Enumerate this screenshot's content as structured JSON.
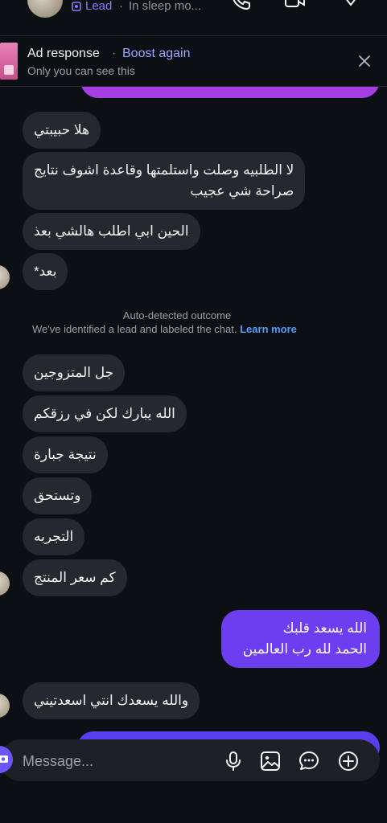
{
  "header": {
    "lead_label": "Lead",
    "separator": "·",
    "status": "In sleep mo..."
  },
  "ad_banner": {
    "title": "Ad response",
    "separator": "·",
    "boost_label": "Boost again",
    "subtitle": "Only you can see this"
  },
  "messages_group_1": [
    "هلا حبيبتي",
    "لا الطلبيه وصلت واستلمتها وقاعدة اشوف نتايج",
    "صراحة شي عجيب",
    "الحين ابي اطلب هالشي بعذ",
    "بعد*"
  ],
  "outcome": {
    "title": "Auto-detected outcome",
    "description": "We've identified a lead and labeled the chat.",
    "link": "Learn more"
  },
  "messages_group_2": [
    "جل المتزوجين",
    "الله يبارك لكن في رزقكم",
    "نتيجة جبارة",
    "وتستحق",
    "التجربه",
    "كم سعر المنتج"
  ],
  "outgoing_message": {
    "line1": "الله يسعد قلبك",
    "line2": "الحمد لله رب العالمين"
  },
  "messages_group_3": [
    "والله يسعدك انتي اسعدتيني"
  ],
  "composer": {
    "placeholder": "Message..."
  },
  "colors": {
    "background": "#0c0f14",
    "incoming_bubble": "#25282e",
    "outgoing_bubble": "#6d3ef0",
    "accent_lead": "#8b7cf6",
    "link": "#4d9dff"
  }
}
